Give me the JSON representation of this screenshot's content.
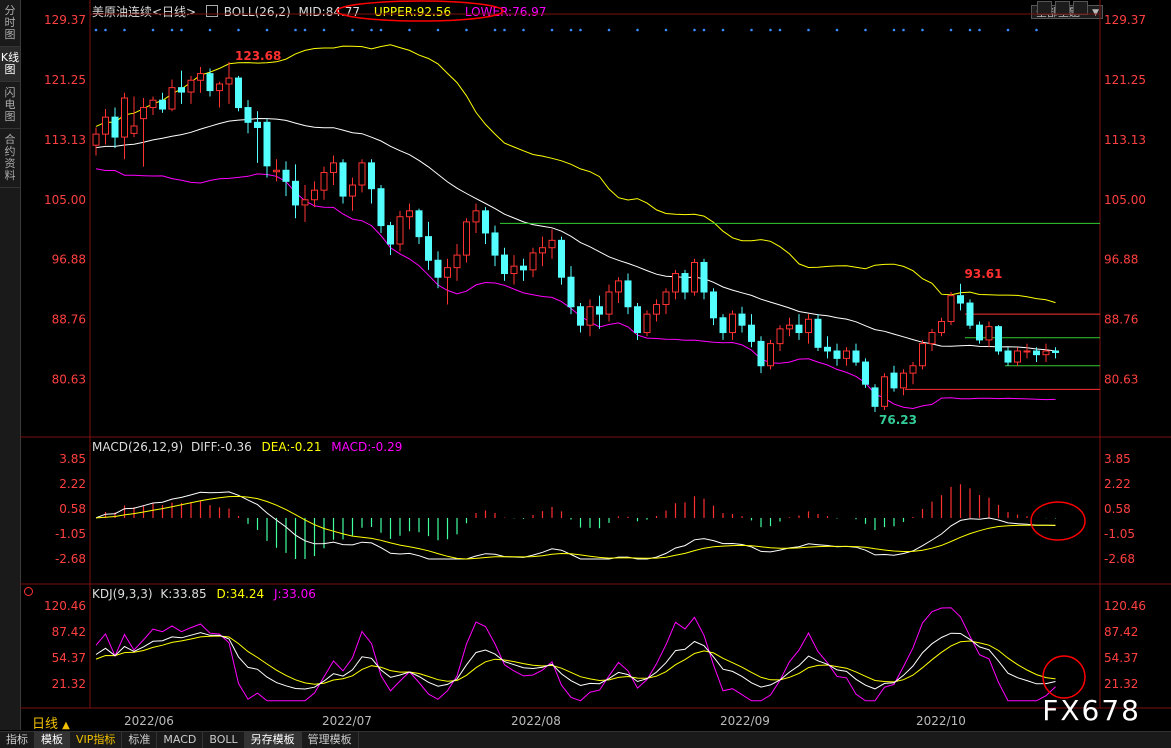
{
  "left_tabs": [
    "分时图",
    "K线图",
    "闪电图",
    "合约资料"
  ],
  "header": {
    "title": "美原油连续<日线>",
    "boll_label": "BOLL(26,2)",
    "mid": "MID:84.77",
    "upper": "UPPER:92.56",
    "lower": "LOWER:76.97",
    "theme_button": "全部主题"
  },
  "macd_header": {
    "label": "MACD(26,12,9)",
    "diff": "DIFF:-0.36",
    "dea": "DEA:-0.21",
    "macd": "MACD:-0.29"
  },
  "kdj_header": {
    "label": "KDJ(9,3,3)",
    "k": "K:33.85",
    "d": "D:34.24",
    "j": "J:33.06"
  },
  "price_axis_labels": [
    "129.37",
    "121.25",
    "113.13",
    "105.00",
    "96.88",
    "88.76",
    "80.63"
  ],
  "macd_axis_labels": [
    "3.85",
    "2.22",
    "0.58",
    "-1.05",
    "-2.68"
  ],
  "kdj_axis_labels": [
    "120.46",
    "87.42",
    "54.37",
    "21.32"
  ],
  "date_labels": [
    "2022/06",
    "2022/07",
    "2022/08",
    "2022/09",
    "2022/10"
  ],
  "period": "日线",
  "bottom_tabs": [
    "指标",
    "模板",
    "VIP指标",
    "标准",
    "MACD",
    "BOLL",
    "另存模板",
    "管理模板"
  ],
  "watermark": "FX678",
  "colors": {
    "up": "#ff3232",
    "down": "#54ffff",
    "mid": "#ffffff",
    "upper": "#ffff00",
    "lower": "#ff00ff",
    "axis": "#ff4040",
    "dea": "#ffff00",
    "diff": "#ffffff",
    "annot_circle": "#ff0000"
  },
  "chart_data": {
    "type": "candlestick",
    "title": "美原油连续<日线>",
    "ylim": [
      76.23,
      129.37
    ],
    "annotations": [
      {
        "text": "123.68",
        "kind": "high"
      },
      {
        "text": "93.61",
        "kind": "high"
      },
      {
        "text": "76.23",
        "kind": "low"
      }
    ],
    "ohlc": [
      {
        "o": 112.4,
        "h": 114.8,
        "l": 111.0,
        "c": 113.9
      },
      {
        "o": 113.9,
        "h": 117.3,
        "l": 112.5,
        "c": 116.2
      },
      {
        "o": 116.2,
        "h": 117.5,
        "l": 112.0,
        "c": 113.5
      },
      {
        "o": 113.5,
        "h": 119.5,
        "l": 110.5,
        "c": 118.8
      },
      {
        "o": 114.0,
        "h": 119.0,
        "l": 113.5,
        "c": 115.0
      },
      {
        "o": 116.0,
        "h": 118.8,
        "l": 109.5,
        "c": 117.5
      },
      {
        "o": 117.5,
        "h": 119.0,
        "l": 116.5,
        "c": 118.5
      },
      {
        "o": 118.5,
        "h": 119.5,
        "l": 116.8,
        "c": 117.3
      },
      {
        "o": 117.3,
        "h": 121.3,
        "l": 117.0,
        "c": 120.2
      },
      {
        "o": 120.2,
        "h": 122.5,
        "l": 118.0,
        "c": 119.6
      },
      {
        "o": 119.6,
        "h": 121.8,
        "l": 118.0,
        "c": 121.2
      },
      {
        "o": 121.2,
        "h": 123.0,
        "l": 119.5,
        "c": 122.1
      },
      {
        "o": 122.1,
        "h": 122.8,
        "l": 119.0,
        "c": 119.8
      },
      {
        "o": 119.8,
        "h": 121.0,
        "l": 117.5,
        "c": 120.7
      },
      {
        "o": 120.7,
        "h": 123.68,
        "l": 118.0,
        "c": 121.5
      },
      {
        "o": 121.5,
        "h": 121.8,
        "l": 117.0,
        "c": 117.5
      },
      {
        "o": 117.5,
        "h": 118.5,
        "l": 114.0,
        "c": 115.5
      },
      {
        "o": 115.5,
        "h": 117.0,
        "l": 110.0,
        "c": 114.8
      },
      {
        "o": 115.5,
        "h": 116.0,
        "l": 108.0,
        "c": 109.6
      },
      {
        "o": 108.8,
        "h": 110.5,
        "l": 107.5,
        "c": 109.0
      },
      {
        "o": 109.0,
        "h": 110.2,
        "l": 105.5,
        "c": 107.5
      },
      {
        "o": 107.5,
        "h": 109.8,
        "l": 102.5,
        "c": 104.3
      },
      {
        "o": 104.3,
        "h": 107.0,
        "l": 102.0,
        "c": 105.0
      },
      {
        "o": 105.0,
        "h": 107.5,
        "l": 104.0,
        "c": 106.3
      },
      {
        "o": 106.3,
        "h": 109.5,
        "l": 105.0,
        "c": 108.7
      },
      {
        "o": 108.7,
        "h": 111.0,
        "l": 107.0,
        "c": 110.0
      },
      {
        "o": 110.0,
        "h": 110.5,
        "l": 104.5,
        "c": 105.5
      },
      {
        "o": 105.5,
        "h": 108.0,
        "l": 103.5,
        "c": 107.0
      },
      {
        "o": 107.0,
        "h": 110.5,
        "l": 106.0,
        "c": 110.0
      },
      {
        "o": 110.0,
        "h": 110.5,
        "l": 104.5,
        "c": 106.5
      },
      {
        "o": 106.5,
        "h": 107.0,
        "l": 100.5,
        "c": 101.5
      },
      {
        "o": 101.5,
        "h": 102.0,
        "l": 97.5,
        "c": 99.0
      },
      {
        "o": 99.0,
        "h": 103.5,
        "l": 98.0,
        "c": 102.7
      },
      {
        "o": 102.7,
        "h": 104.5,
        "l": 101.0,
        "c": 103.5
      },
      {
        "o": 103.5,
        "h": 103.8,
        "l": 99.0,
        "c": 100.0
      },
      {
        "o": 100.0,
        "h": 102.0,
        "l": 95.5,
        "c": 96.8
      },
      {
        "o": 96.8,
        "h": 98.0,
        "l": 93.0,
        "c": 94.5
      },
      {
        "o": 94.5,
        "h": 97.0,
        "l": 90.8,
        "c": 95.8
      },
      {
        "o": 95.8,
        "h": 99.0,
        "l": 94.0,
        "c": 97.5
      },
      {
        "o": 97.5,
        "h": 102.5,
        "l": 96.5,
        "c": 102.0
      },
      {
        "o": 102.0,
        "h": 104.5,
        "l": 100.5,
        "c": 103.5
      },
      {
        "o": 103.5,
        "h": 104.0,
        "l": 99.0,
        "c": 100.5
      },
      {
        "o": 100.5,
        "h": 101.5,
        "l": 96.0,
        "c": 97.5
      },
      {
        "o": 97.5,
        "h": 98.5,
        "l": 94.0,
        "c": 95.0
      },
      {
        "o": 95.0,
        "h": 97.5,
        "l": 93.5,
        "c": 96.0
      },
      {
        "o": 96.0,
        "h": 97.0,
        "l": 94.0,
        "c": 95.5
      },
      {
        "o": 95.5,
        "h": 98.5,
        "l": 94.5,
        "c": 97.8
      },
      {
        "o": 97.8,
        "h": 100.0,
        "l": 96.0,
        "c": 98.5
      },
      {
        "o": 98.5,
        "h": 101.0,
        "l": 97.0,
        "c": 99.5
      },
      {
        "o": 99.5,
        "h": 100.0,
        "l": 93.5,
        "c": 94.5
      },
      {
        "o": 94.5,
        "h": 96.0,
        "l": 89.5,
        "c": 90.5
      },
      {
        "o": 90.5,
        "h": 91.0,
        "l": 87.0,
        "c": 88.0
      },
      {
        "o": 88.0,
        "h": 91.5,
        "l": 86.5,
        "c": 90.5
      },
      {
        "o": 90.5,
        "h": 92.0,
        "l": 87.5,
        "c": 89.5
      },
      {
        "o": 89.5,
        "h": 93.5,
        "l": 88.5,
        "c": 92.5
      },
      {
        "o": 92.5,
        "h": 94.5,
        "l": 91.0,
        "c": 94.0
      },
      {
        "o": 94.0,
        "h": 95.0,
        "l": 89.5,
        "c": 90.5
      },
      {
        "o": 90.5,
        "h": 91.0,
        "l": 86.0,
        "c": 87.0
      },
      {
        "o": 87.0,
        "h": 90.0,
        "l": 86.5,
        "c": 89.5
      },
      {
        "o": 89.5,
        "h": 91.5,
        "l": 88.5,
        "c": 90.8
      },
      {
        "o": 90.8,
        "h": 93.0,
        "l": 89.5,
        "c": 92.5
      },
      {
        "o": 92.5,
        "h": 95.5,
        "l": 91.5,
        "c": 95.0
      },
      {
        "o": 95.0,
        "h": 95.5,
        "l": 91.5,
        "c": 92.5
      },
      {
        "o": 92.5,
        "h": 97.0,
        "l": 92.0,
        "c": 96.5
      },
      {
        "o": 96.5,
        "h": 97.0,
        "l": 91.5,
        "c": 92.5
      },
      {
        "o": 92.5,
        "h": 93.0,
        "l": 88.0,
        "c": 89.0
      },
      {
        "o": 89.0,
        "h": 89.5,
        "l": 86.0,
        "c": 87.0
      },
      {
        "o": 87.0,
        "h": 90.0,
        "l": 86.0,
        "c": 89.5
      },
      {
        "o": 89.5,
        "h": 90.5,
        "l": 87.0,
        "c": 88.0
      },
      {
        "o": 88.0,
        "h": 89.5,
        "l": 85.0,
        "c": 85.8
      },
      {
        "o": 85.8,
        "h": 86.5,
        "l": 81.5,
        "c": 82.5
      },
      {
        "o": 82.5,
        "h": 86.0,
        "l": 82.0,
        "c": 85.5
      },
      {
        "o": 85.5,
        "h": 88.0,
        "l": 84.5,
        "c": 87.5
      },
      {
        "o": 87.5,
        "h": 89.0,
        "l": 86.5,
        "c": 88.0
      },
      {
        "o": 88.0,
        "h": 89.5,
        "l": 86.0,
        "c": 87.0
      },
      {
        "o": 87.0,
        "h": 89.5,
        "l": 85.5,
        "c": 88.8
      },
      {
        "o": 88.8,
        "h": 89.5,
        "l": 84.5,
        "c": 85.0
      },
      {
        "o": 85.0,
        "h": 86.5,
        "l": 83.5,
        "c": 84.5
      },
      {
        "o": 84.5,
        "h": 85.5,
        "l": 82.5,
        "c": 83.5
      },
      {
        "o": 83.5,
        "h": 85.0,
        "l": 82.5,
        "c": 84.5
      },
      {
        "o": 84.5,
        "h": 85.5,
        "l": 82.5,
        "c": 83.0
      },
      {
        "o": 83.0,
        "h": 83.5,
        "l": 79.5,
        "c": 80.0
      },
      {
        "o": 79.5,
        "h": 80.0,
        "l": 76.23,
        "c": 77.0
      },
      {
        "o": 77.0,
        "h": 81.5,
        "l": 76.5,
        "c": 81.0
      },
      {
        "o": 81.5,
        "h": 82.5,
        "l": 79.0,
        "c": 79.5
      },
      {
        "o": 79.5,
        "h": 82.0,
        "l": 78.5,
        "c": 81.5
      },
      {
        "o": 81.5,
        "h": 83.0,
        "l": 80.0,
        "c": 82.5
      },
      {
        "o": 82.5,
        "h": 86.0,
        "l": 82.0,
        "c": 85.5
      },
      {
        "o": 85.5,
        "h": 87.5,
        "l": 84.5,
        "c": 87.0
      },
      {
        "o": 87.0,
        "h": 89.0,
        "l": 86.5,
        "c": 88.5
      },
      {
        "o": 88.5,
        "h": 92.5,
        "l": 88.0,
        "c": 92.0
      },
      {
        "o": 92.0,
        "h": 93.61,
        "l": 90.0,
        "c": 91.0
      },
      {
        "o": 91.0,
        "h": 91.5,
        "l": 87.5,
        "c": 88.0
      },
      {
        "o": 88.0,
        "h": 88.5,
        "l": 85.5,
        "c": 86.0
      },
      {
        "o": 86.0,
        "h": 88.5,
        "l": 85.0,
        "c": 87.8
      },
      {
        "o": 87.8,
        "h": 88.0,
        "l": 84.0,
        "c": 84.5
      },
      {
        "o": 84.5,
        "h": 85.0,
        "l": 82.5,
        "c": 83.0
      },
      {
        "o": 83.0,
        "h": 85.0,
        "l": 82.5,
        "c": 84.5
      },
      {
        "o": 84.5,
        "h": 85.5,
        "l": 83.5,
        "c": 84.5
      },
      {
        "o": 84.5,
        "h": 85.0,
        "l": 83.0,
        "c": 84.0
      },
      {
        "o": 84.0,
        "h": 85.5,
        "l": 83.0,
        "c": 84.5
      },
      {
        "o": 84.5,
        "h": 85.0,
        "l": 83.5,
        "c": 84.3
      }
    ]
  }
}
